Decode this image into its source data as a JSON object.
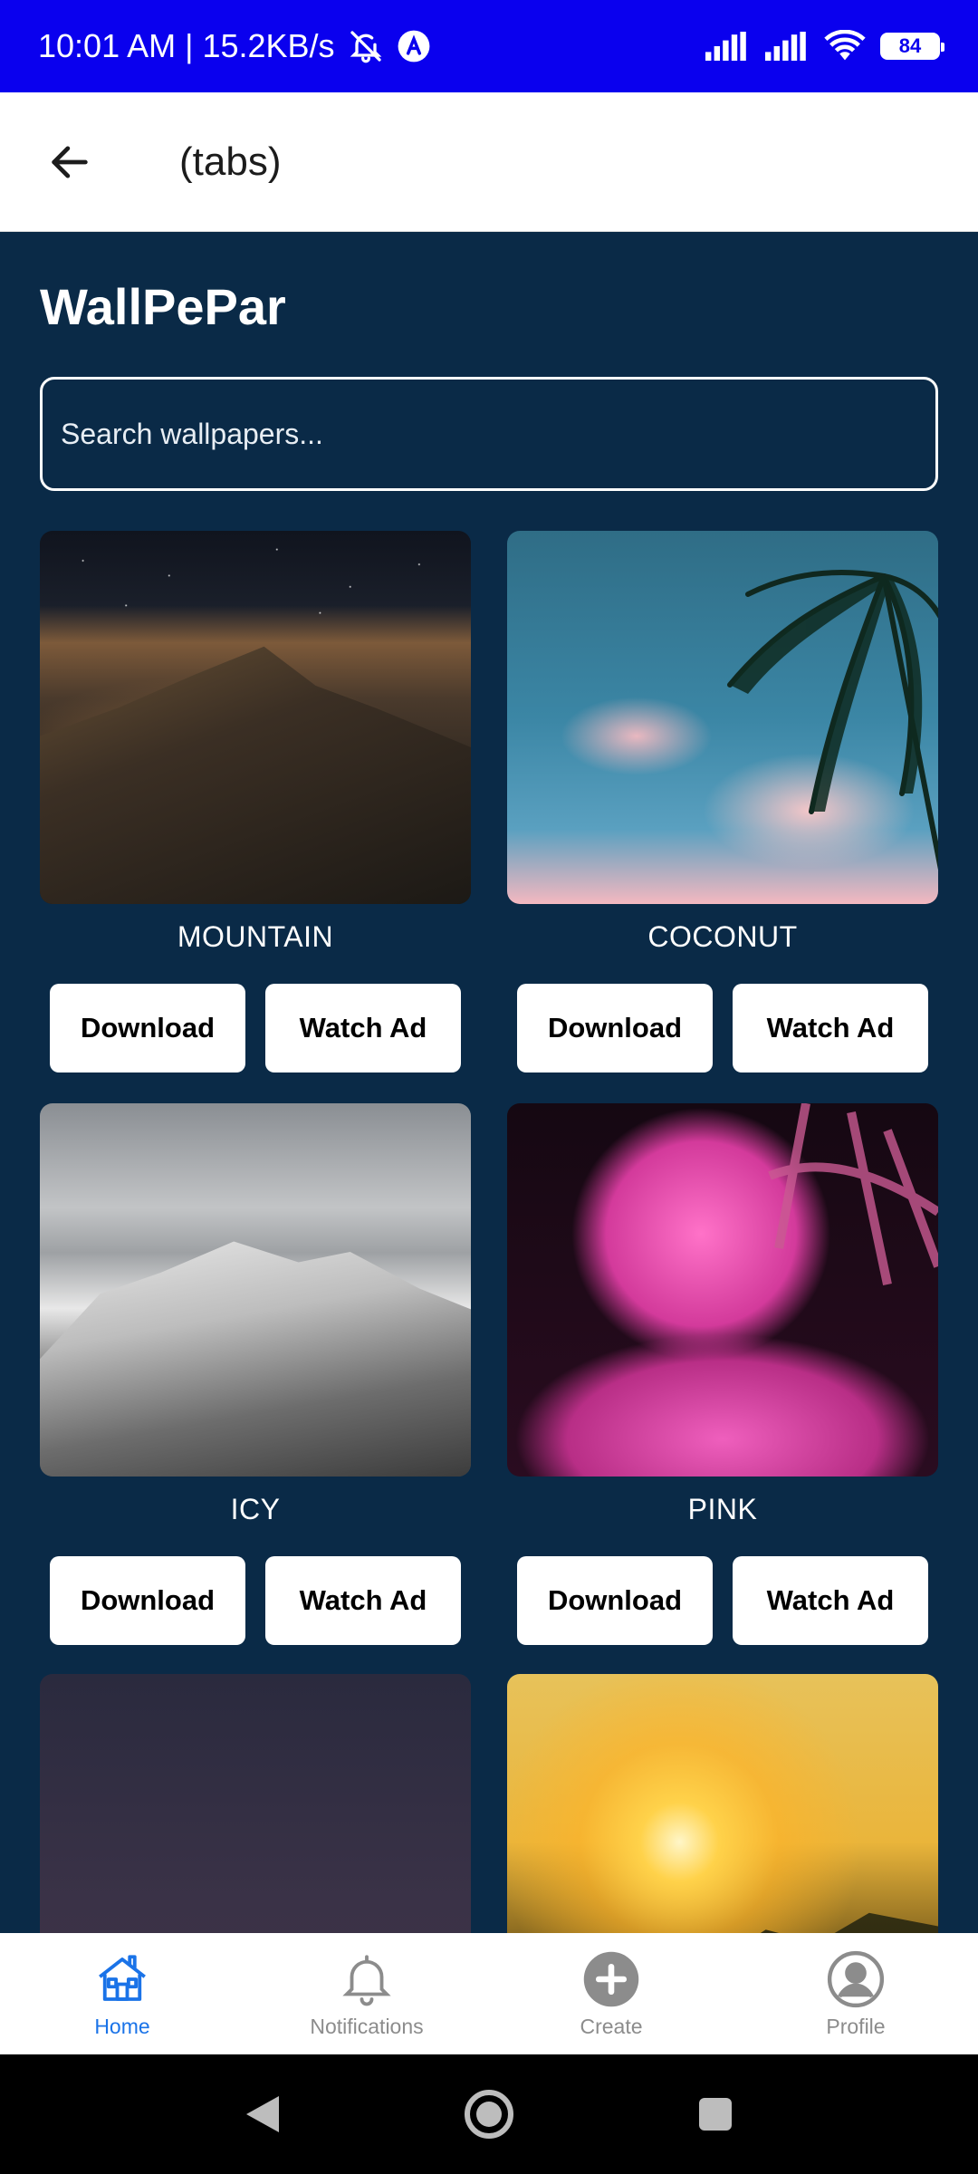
{
  "status_bar": {
    "time_speed": "10:01 AM | 15.2KB/s",
    "battery": "84",
    "icons": [
      "bell-off-icon",
      "app-a-icon",
      "signal-icon",
      "signal-icon",
      "wifi-icon",
      "battery-icon"
    ]
  },
  "header": {
    "title": "(tabs)",
    "back_icon": "arrow-left-icon"
  },
  "main": {
    "app_title": "WallPePar",
    "search_placeholder": "Search wallpapers...",
    "cards": [
      {
        "name": "MOUNTAIN",
        "download": "Download",
        "watch_ad": "Watch Ad"
      },
      {
        "name": "COCONUT",
        "download": "Download",
        "watch_ad": "Watch Ad"
      },
      {
        "name": "ICY",
        "download": "Download",
        "watch_ad": "Watch Ad"
      },
      {
        "name": "PINK",
        "download": "Download",
        "watch_ad": "Watch Ad"
      }
    ]
  },
  "bottom_nav": [
    {
      "label": "Home",
      "icon": "home-icon",
      "active": true
    },
    {
      "label": "Notifications",
      "icon": "bell-icon",
      "active": false
    },
    {
      "label": "Create",
      "icon": "plus-circle-icon",
      "active": false
    },
    {
      "label": "Profile",
      "icon": "user-circle-icon",
      "active": false
    }
  ],
  "colors": {
    "status_bar": "#0a00ee",
    "background": "#0a2a47",
    "accent": "#1a73e8",
    "nav_inactive": "#8c8c8c"
  }
}
